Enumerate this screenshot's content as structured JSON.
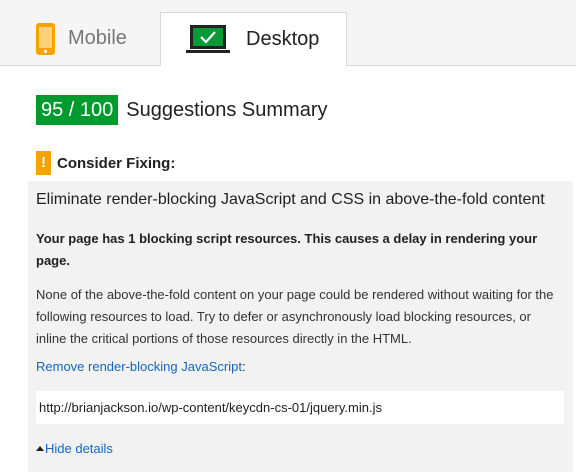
{
  "tabs": [
    {
      "label": "Mobile",
      "icon": "phone-icon",
      "active": false
    },
    {
      "label": "Desktop",
      "icon": "desktop-icon",
      "active": true
    }
  ],
  "summary": {
    "score": "95 / 100",
    "title": "Suggestions Summary",
    "score_color": "#009a2f"
  },
  "consider": {
    "icon_text": "!",
    "label": "Consider Fixing:",
    "color": "#f4a300"
  },
  "rule": {
    "title": "Eliminate render-blocking JavaScript and CSS in above-the-fold content",
    "summary": "Your page has 1 blocking script resources. This causes a delay in rendering your page.",
    "description": "None of the above-the-fold content on your page could be rendered without waiting for the following resources to load. Try to defer or asynchronously load blocking resources, or inline the critical portions of those resources directly in the HTML.",
    "link_text": "Remove render-blocking JavaScript",
    "link_suffix": ":",
    "resource": "http://brianjackson.io/wp-content/keycdn-cs-01/jquery.min.js",
    "hide_details": "Hide details"
  }
}
